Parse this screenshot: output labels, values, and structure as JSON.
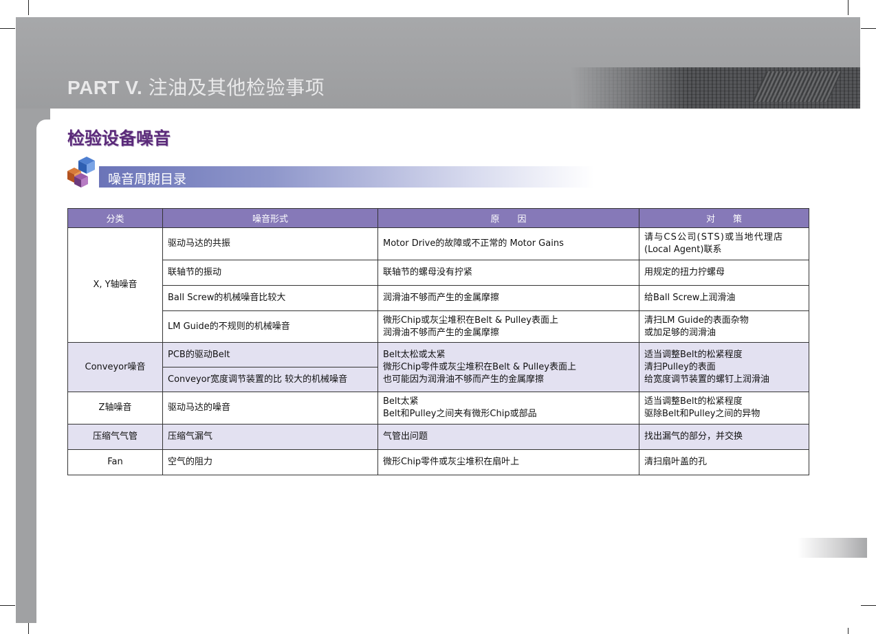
{
  "header": {
    "part_label": "PART V.",
    "part_title": "注油及其他检验事项"
  },
  "section_title": "检验设备噪音",
  "subsection_title": "噪音周期目录",
  "table": {
    "headers": [
      "分类",
      "噪音形式",
      "原　　因",
      "对　　策"
    ],
    "groups": [
      {
        "category": "X, Y轴噪音",
        "shaded": false,
        "rows": [
          {
            "form": [
              "驱动马达的共振"
            ],
            "cause": [
              "Motor Drive的故障或不正常的 Motor Gains"
            ],
            "action": [
              "请与CS公司(STS)或当地代理店",
              "(Local Agent)联系"
            ]
          },
          {
            "form": [
              "联轴节的振动"
            ],
            "cause": [
              "联轴节的螺母没有拧紧"
            ],
            "action": [
              "用规定的扭力拧螺母"
            ]
          },
          {
            "form": [
              "Ball Screw的机械噪音比较大"
            ],
            "cause": [
              "润滑油不够而产生的金属摩擦"
            ],
            "action": [
              "给Ball Screw上润滑油"
            ]
          },
          {
            "form": [
              "LM Guide的不规则的机械噪音"
            ],
            "cause": [
              "微形Chip或灰尘堆积在Belt & Pulley表面上",
              "润滑油不够而产生的金属摩擦"
            ],
            "action": [
              "清扫LM Guide的表面杂物",
              "或加足够的润滑油"
            ]
          }
        ]
      },
      {
        "category": "Conveyor噪音",
        "shaded": true,
        "forms": [
          "PCB的驱动Belt",
          "Conveyor宽度调节装置的比 较大的机械噪音"
        ],
        "cause": [
          "Belt太松或太紧",
          "微形Chip零件或灰尘堆积在Belt & Pulley表面上",
          "也可能因为润滑油不够而产生的金属摩擦"
        ],
        "action": [
          "适当调整Belt的松紧程度",
          "清扫Pulley的表面",
          "给宽度调节装置的螺钉上润滑油"
        ]
      },
      {
        "category": "Z轴噪音",
        "shaded": false,
        "form": [
          "驱动马达的噪音"
        ],
        "cause": [
          "Belt太紧",
          "Belt和Pulley之间夹有微形Chip或部品"
        ],
        "action": [
          "适当调整Belt的松紧程度",
          "驱除Belt和Pulley之间的异物"
        ]
      },
      {
        "category": "压缩气气管",
        "shaded": true,
        "form": [
          "压缩气漏气"
        ],
        "cause": [
          "气管出问题"
        ],
        "action": [
          "找出漏气的部分，并交换"
        ]
      },
      {
        "category": "Fan",
        "shaded": false,
        "form": [
          "空气的阻力"
        ],
        "cause": [
          "微形Chip零件或灰尘堆积在扇叶上"
        ],
        "action": [
          "清扫扇叶盖的孔"
        ]
      }
    ]
  },
  "colors": {
    "header_bg": "#a0a1a3",
    "table_header": "#8679b8",
    "shaded_row": "#e3e1f1",
    "section_title": "#5b2a7a"
  }
}
